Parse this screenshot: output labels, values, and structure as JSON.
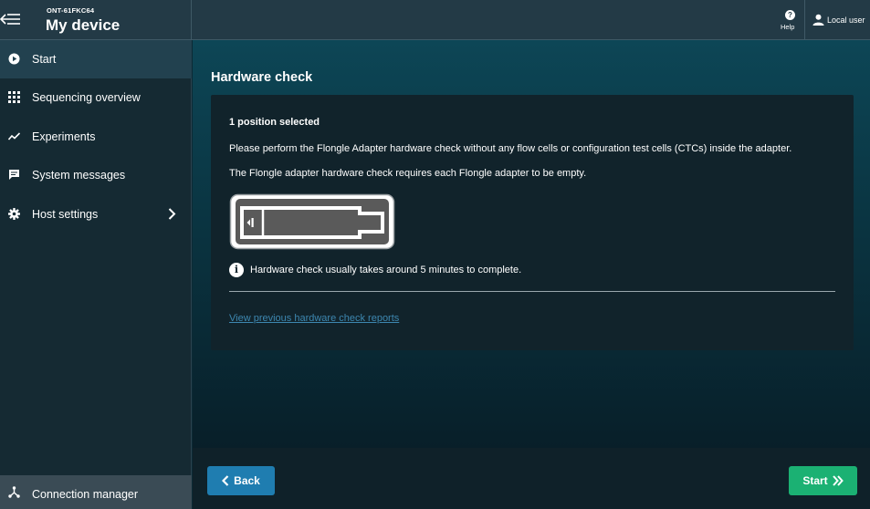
{
  "header": {
    "device_id": "ONT-61FKC64",
    "device_name": "My device",
    "help_label": "Help",
    "user_label": "Local user",
    "menu_icon": "menu-collapse-icon",
    "help_icon": "help-icon",
    "user_icon": "user-icon"
  },
  "sidebar": {
    "items": [
      {
        "label": "Start",
        "icon": "play-icon",
        "active": true
      },
      {
        "label": "Sequencing overview",
        "icon": "grid-icon",
        "active": false
      },
      {
        "label": "Experiments",
        "icon": "trend-icon",
        "active": false
      },
      {
        "label": "System messages",
        "icon": "message-icon",
        "active": false
      },
      {
        "label": "Host settings",
        "icon": "gear-icon",
        "active": false
      }
    ],
    "footer_item": {
      "label": "Connection manager",
      "icon": "network-icon"
    }
  },
  "main": {
    "title": "Hardware check",
    "selected": "1 position selected",
    "instruction_1": "Please perform the Flongle Adapter hardware check without any flow cells or configuration test cells (CTCs) inside the adapter.",
    "instruction_2": "The Flongle adapter hardware check requires each Flongle adapter to be empty.",
    "info_text": "Hardware check usually takes around 5 minutes to complete.",
    "reports_link": "View previous hardware check reports"
  },
  "footer": {
    "back_label": "Back",
    "start_label": "Start"
  },
  "colors": {
    "accent_blue": "#1f7db0",
    "accent_green": "#1bb173",
    "link": "#3d87b0"
  }
}
